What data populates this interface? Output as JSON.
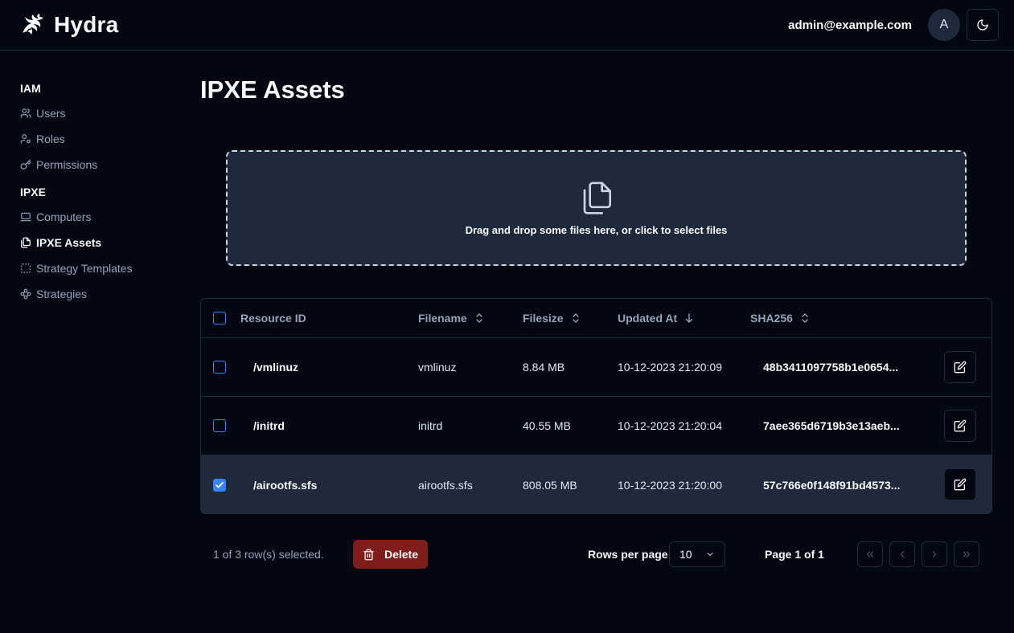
{
  "header": {
    "app_name": "Hydra",
    "user_email": "admin@example.com",
    "avatar_initial": "A"
  },
  "sidebar": {
    "sections": [
      {
        "title": "IAM",
        "items": [
          {
            "label": "Users",
            "icon": "users-icon"
          },
          {
            "label": "Roles",
            "icon": "user-key-icon"
          },
          {
            "label": "Permissions",
            "icon": "key-icon"
          }
        ]
      },
      {
        "title": "IPXE",
        "items": [
          {
            "label": "Computers",
            "icon": "laptop-icon"
          },
          {
            "label": "IPXE Assets",
            "icon": "files-icon",
            "active": true
          },
          {
            "label": "Strategy Templates",
            "icon": "dashed-square-icon"
          },
          {
            "label": "Strategies",
            "icon": "workflow-icon"
          }
        ]
      }
    ]
  },
  "page": {
    "title": "IPXE Assets"
  },
  "dropzone": {
    "text": "Drag and drop some files here, or click to select files"
  },
  "table": {
    "columns": {
      "resource_id": "Resource ID",
      "filename": "Filename",
      "filesize": "Filesize",
      "updated_at": "Updated At",
      "sha256": "SHA256"
    },
    "rows": [
      {
        "resource_id": "/vmlinuz",
        "filename": "vmlinuz",
        "filesize": "8.84 MB",
        "updated_at": "10-12-2023 21:20:09",
        "sha256": "48b3411097758b1e0654...",
        "selected": false
      },
      {
        "resource_id": "/initrd",
        "filename": "initrd",
        "filesize": "40.55 MB",
        "updated_at": "10-12-2023 21:20:04",
        "sha256": "7aee365d6719b3e13aeb...",
        "selected": false
      },
      {
        "resource_id": "/airootfs.sfs",
        "filename": "airootfs.sfs",
        "filesize": "808.05 MB",
        "updated_at": "10-12-2023 21:20:00",
        "sha256": "57c766e0f148f91bd4573...",
        "selected": true
      }
    ]
  },
  "footer": {
    "selection_text": "1 of 3 row(s) selected.",
    "delete_label": "Delete",
    "rows_per_page_label": "Rows per page",
    "rows_per_page_value": "10",
    "page_info": "Page 1 of 1"
  },
  "colors": {
    "background": "#030712",
    "accent": "#3b82f6",
    "danger": "#7f1d1d",
    "panel": "#1e293b"
  }
}
